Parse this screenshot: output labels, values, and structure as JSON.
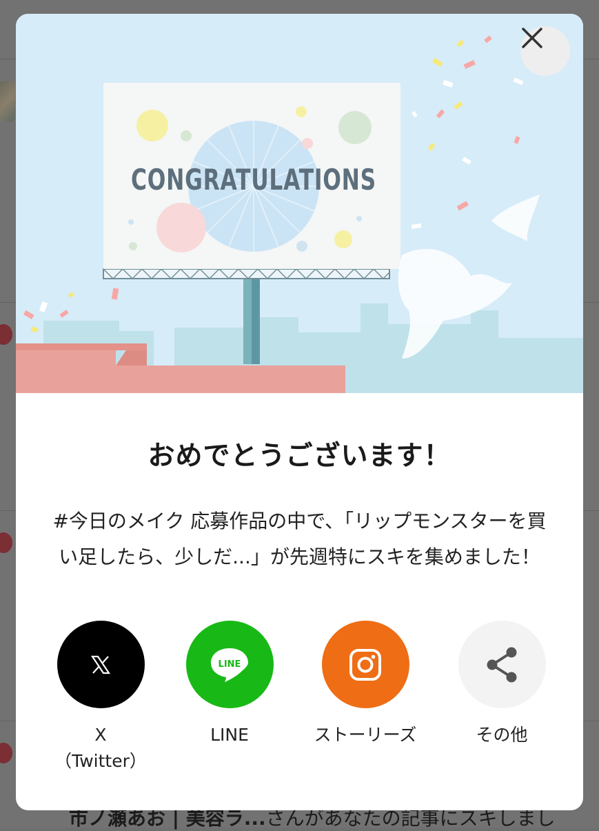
{
  "background": {
    "bottom_author": "市ノ瀬あお | 美容ラ...",
    "bottom_text": "さんがあなたの記事にスキしまし"
  },
  "modal": {
    "close_label": "×",
    "hero": {
      "billboard_text": "CONGRATULATIONS"
    },
    "title": "おめでとうございます！",
    "message": "#今日のメイク 応募作品の中で、「リップモンスターを買い足したら、少しだ...」が先週特にスキを集めました！",
    "share": [
      {
        "label": "X\n（Twitter）",
        "icon": "x-logo-icon",
        "color": "#000000"
      },
      {
        "label": "LINE",
        "icon": "line-logo-icon",
        "color": "#18b916",
        "icon_text": "LINE"
      },
      {
        "label": "ストーリーズ",
        "icon": "instagram-icon",
        "color": "#ee6d15"
      },
      {
        "label": "その他",
        "icon": "share-icon",
        "color": "#f3f3f3"
      }
    ]
  },
  "colors": {
    "sky": "#d6ecf8",
    "building": "#e9a19b",
    "city": "#b9dfe9"
  }
}
